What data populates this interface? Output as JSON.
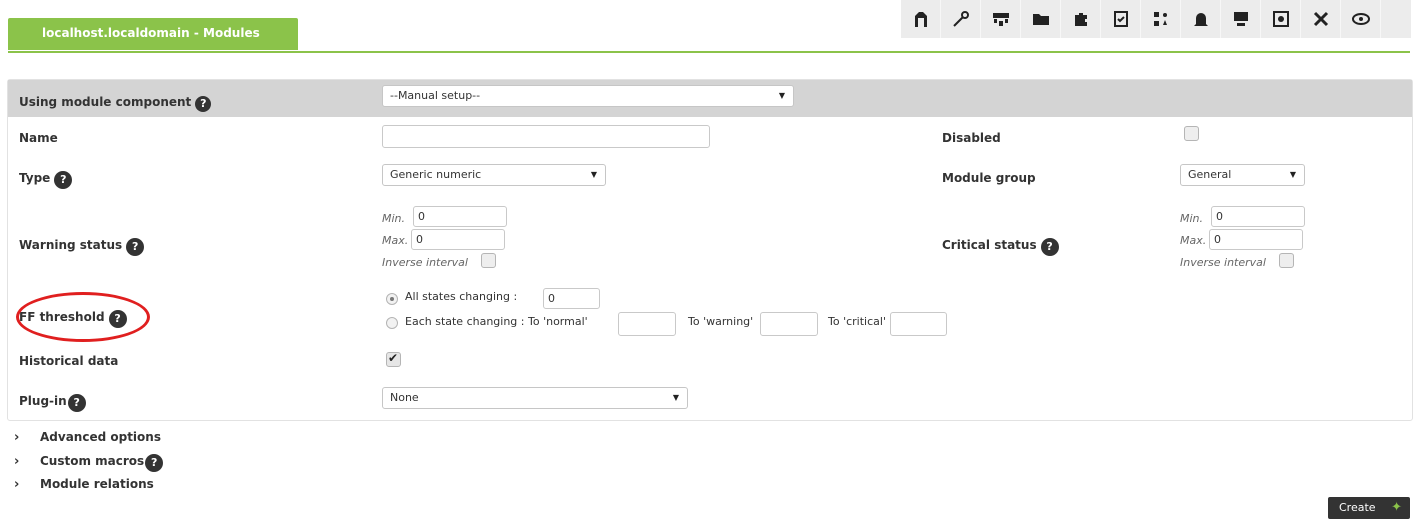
{
  "header": {
    "title": "localhost.localdomain - Modules",
    "toolbar_icons": [
      "manage-icon",
      "wrench-icon",
      "network-icon",
      "folder-icon",
      "puzzle-icon",
      "checklist-icon",
      "modules-icon",
      "alert-bell-icon",
      "agent-icon",
      "inventory-icon",
      "tools-icon",
      "view-icon"
    ]
  },
  "form": {
    "component_label": "Using module component",
    "component_value": "--Manual setup--",
    "name_label": "Name",
    "name_value": "",
    "disabled_label": "Disabled",
    "type_label": "Type",
    "type_value": "Generic numeric",
    "group_label": "Module group",
    "group_value": "General",
    "warning_label": "Warning status",
    "critical_label": "Critical status",
    "min_label": "Min.",
    "max_label": "Max.",
    "warning_min": "0",
    "warning_max": "0",
    "critical_min": "0",
    "critical_max": "0",
    "inverse_label": "Inverse interval",
    "ff_label": "FF threshold",
    "all_states_label": "All states changing :",
    "all_states_value": "0",
    "each_state_label": "Each state changing : To 'normal'",
    "to_warning_label": "To 'warning'",
    "to_critical_label": "To 'critical'",
    "historical_label": "Historical data",
    "plugin_label": "Plug-in",
    "plugin_value": "None",
    "help_glyph": "?"
  },
  "sections": {
    "advanced": "Advanced options",
    "macros": "Custom macros",
    "relations": "Module relations"
  },
  "actions": {
    "create": "Create"
  },
  "colors": {
    "accent": "#8bc34a",
    "band": "#d4d4d4",
    "highlight_ring": "#e01f1f"
  }
}
